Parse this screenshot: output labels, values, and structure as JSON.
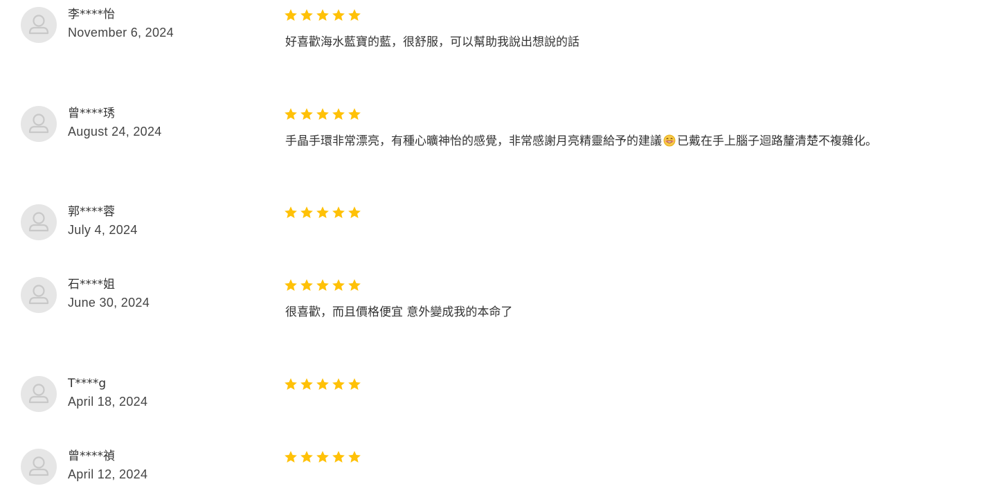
{
  "colors": {
    "star": "#FFC107",
    "avatar_bg": "#E6E6E6",
    "avatar_fg": "#C8C8C8"
  },
  "reviews": [
    {
      "name": "李****怡",
      "date": "November 6, 2024",
      "rating": 5,
      "text": "好喜歡海水藍寶的藍，很舒服，可以幫助我說出想說的話",
      "text_after_emoji": ""
    },
    {
      "name": "曾****琇",
      "date": "August 24, 2024",
      "rating": 5,
      "text": "手晶手環非常漂亮，有種心曠神怡的感覺，非常感謝月亮精靈給予的建議",
      "emoji": "grinning-face-with-teeth",
      "text_after_emoji": "已戴在手上腦子迴路釐清楚不複雜化。"
    },
    {
      "name": "郭****蓉",
      "date": "July 4, 2024",
      "rating": 5,
      "text": "",
      "text_after_emoji": ""
    },
    {
      "name": "石****姐",
      "date": "June 30, 2024",
      "rating": 5,
      "text": "很喜歡，而且價格便宜 意外變成我的本命了",
      "text_after_emoji": ""
    },
    {
      "name": "T****g",
      "date": "April 18, 2024",
      "rating": 5,
      "text": "",
      "text_after_emoji": ""
    },
    {
      "name": "曾****禎",
      "date": "April 12, 2024",
      "rating": 5,
      "text": "",
      "text_after_emoji": ""
    }
  ]
}
